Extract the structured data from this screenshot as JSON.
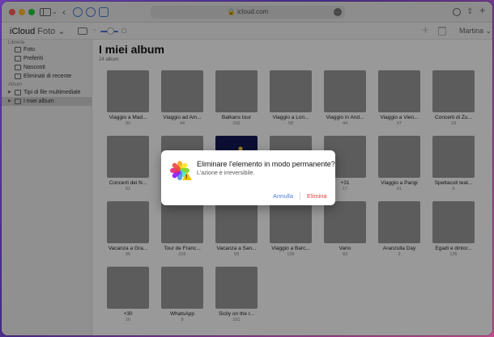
{
  "browser": {
    "url": "icloud.com",
    "lock_icon": "🔒"
  },
  "app": {
    "brand": "iCloud",
    "section": "Foto",
    "user": "Martina"
  },
  "sidebar": {
    "library_header": "Libreria",
    "library_items": [
      {
        "label": "Foto",
        "icon": "photo-icon"
      },
      {
        "label": "Preferiti",
        "icon": "heart-icon"
      },
      {
        "label": "Nascosti",
        "icon": "hidden-icon"
      },
      {
        "label": "Eliminati di recente",
        "icon": "trash-icon"
      }
    ],
    "albums_header": "Album",
    "album_items": [
      {
        "label": "Tipi di file multimediale",
        "icon": "folder-icon",
        "selected": false
      },
      {
        "label": "I miei album",
        "icon": "folder-icon",
        "selected": true
      }
    ]
  },
  "main": {
    "title": "I miei album",
    "subtitle": "24 album",
    "albums": [
      {
        "name": "Viaggio a Mad...",
        "count": "92"
      },
      {
        "name": "Viaggio ad Am...",
        "count": "44"
      },
      {
        "name": "Balkans tour",
        "count": "266"
      },
      {
        "name": "Viaggio a Lon...",
        "count": "58"
      },
      {
        "name": "Viaggio in And...",
        "count": "44"
      },
      {
        "name": "Viaggio a Vien...",
        "count": "57"
      },
      {
        "name": "Concerti di Zu...",
        "count": "23"
      },
      {
        "name": "Concerti dei N...",
        "count": "62"
      },
      {
        "name": "",
        "count": ""
      },
      {
        "name": "",
        "count": ""
      },
      {
        "name": "",
        "count": ""
      },
      {
        "name": "+31",
        "count": "17"
      },
      {
        "name": "Viaggio a Parigi",
        "count": "61"
      },
      {
        "name": "Spettacoli teat...",
        "count": "6"
      },
      {
        "name": "Vacanza a Gra...",
        "count": "96"
      },
      {
        "name": "Tour de Franc...",
        "count": "226"
      },
      {
        "name": "Vacanza a San...",
        "count": "69"
      },
      {
        "name": "Viaggio a Barc...",
        "count": "139"
      },
      {
        "name": "Vario",
        "count": "83"
      },
      {
        "name": "Aranzulla Day",
        "count": "3"
      },
      {
        "name": "Egadi e dintor...",
        "count": "135"
      },
      {
        "name": "+30",
        "count": "16"
      },
      {
        "name": "WhatsApp",
        "count": "9"
      },
      {
        "name": "Sicily on the r...",
        "count": "161"
      }
    ]
  },
  "dialog": {
    "title": "Eliminare l'elemento in modo permanente?",
    "message": "L'azione è irreversibile.",
    "cancel_label": "Annulla",
    "delete_label": "Elimina"
  },
  "colors": {
    "accent": "#4a7bd6",
    "danger": "#e0453a"
  }
}
